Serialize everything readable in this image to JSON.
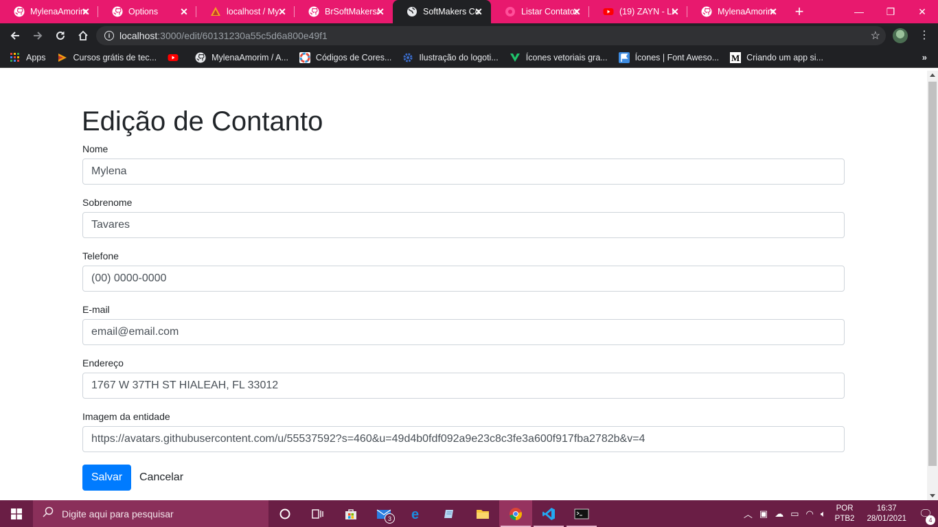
{
  "browser": {
    "tabs": [
      {
        "title": "MylenaAmorim",
        "icon": "github-icon",
        "active": false
      },
      {
        "title": "Options",
        "icon": "github-icon",
        "active": false
      },
      {
        "title": "localhost / My",
        "icon": "phpmyadmin-icon",
        "active": false
      },
      {
        "title": "BrSoftMakers/",
        "icon": "github-icon",
        "active": false
      },
      {
        "title": "SoftMakers Co",
        "icon": "globe-icon",
        "active": true
      },
      {
        "title": "Listar Contatos",
        "icon": "app-icon",
        "active": false
      },
      {
        "title": "(19) ZAYN - LI",
        "icon": "youtube-icon",
        "active": false
      },
      {
        "title": "MylenaAmorim",
        "icon": "github-icon",
        "active": false
      }
    ],
    "address": {
      "host": "localhost",
      "path": ":3000/edit/60131230a55c5d6a800e49f1"
    },
    "bookmarks": [
      {
        "label": "Apps",
        "icon": "apps-grid-icon"
      },
      {
        "label": "Cursos grátis de tec...",
        "icon": "courses-icon"
      },
      {
        "label": "",
        "icon": "youtube-icon"
      },
      {
        "label": "MylenaAmorim / A...",
        "icon": "github-icon"
      },
      {
        "label": "Códigos de Cores...",
        "icon": "color-wheel-icon"
      },
      {
        "label": "Ilustração do logoti...",
        "icon": "gear-icon"
      },
      {
        "label": "Ícones vetoriais gra...",
        "icon": "vector-icon"
      },
      {
        "label": "Ícones | Font Aweso...",
        "icon": "flag-icon"
      },
      {
        "label": "Criando um app si...",
        "icon": "medium-icon"
      }
    ],
    "bookmarks_more": "»"
  },
  "form": {
    "title": "Edição de Contanto",
    "fields": {
      "nome": {
        "label": "Nome",
        "value": "Mylena"
      },
      "sobrenome": {
        "label": "Sobrenome",
        "value": "Tavares"
      },
      "telefone": {
        "label": "Telefone",
        "value": "(00) 0000-0000"
      },
      "email": {
        "label": "E-mail",
        "value": "email@email.com"
      },
      "endereco": {
        "label": "Endereço",
        "value": "1767 W 37TH ST HIALEAH, FL 33012"
      },
      "imagem": {
        "label": "Imagem da entidade",
        "value": "https://avatars.githubusercontent.com/u/55537592?s=460&u=49d4b0fdf092a9e23c8c3fe3a600f917fba2782b&v=4"
      }
    },
    "save_label": "Salvar",
    "cancel_label": "Cancelar"
  },
  "taskbar": {
    "search_placeholder": "Digite aqui para pesquisar",
    "mail_badge": "3",
    "lang_line1": "POR",
    "lang_line2": "PTB2",
    "time": "16:37",
    "date": "28/01/2021",
    "notifications": "4"
  },
  "colors": {
    "tabstrip": "#e8196e",
    "taskbar": "#6a1e45",
    "primary_button": "#007bff"
  }
}
